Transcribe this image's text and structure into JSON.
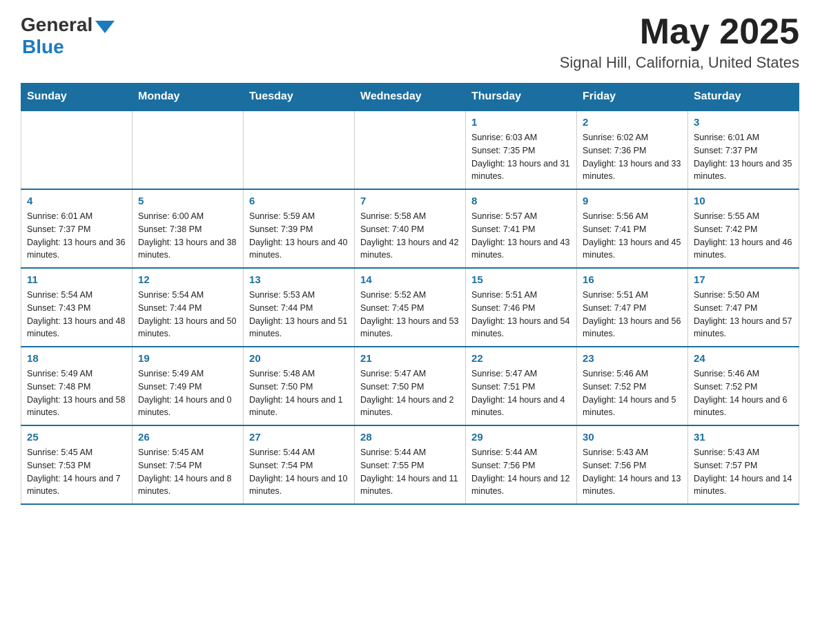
{
  "header": {
    "logo": {
      "general": "General",
      "blue": "Blue"
    },
    "title": "May 2025",
    "location": "Signal Hill, California, United States"
  },
  "calendar": {
    "days_of_week": [
      "Sunday",
      "Monday",
      "Tuesday",
      "Wednesday",
      "Thursday",
      "Friday",
      "Saturday"
    ],
    "weeks": [
      [
        {
          "day": "",
          "info": ""
        },
        {
          "day": "",
          "info": ""
        },
        {
          "day": "",
          "info": ""
        },
        {
          "day": "",
          "info": ""
        },
        {
          "day": "1",
          "info": "Sunrise: 6:03 AM\nSunset: 7:35 PM\nDaylight: 13 hours and 31 minutes."
        },
        {
          "day": "2",
          "info": "Sunrise: 6:02 AM\nSunset: 7:36 PM\nDaylight: 13 hours and 33 minutes."
        },
        {
          "day": "3",
          "info": "Sunrise: 6:01 AM\nSunset: 7:37 PM\nDaylight: 13 hours and 35 minutes."
        }
      ],
      [
        {
          "day": "4",
          "info": "Sunrise: 6:01 AM\nSunset: 7:37 PM\nDaylight: 13 hours and 36 minutes."
        },
        {
          "day": "5",
          "info": "Sunrise: 6:00 AM\nSunset: 7:38 PM\nDaylight: 13 hours and 38 minutes."
        },
        {
          "day": "6",
          "info": "Sunrise: 5:59 AM\nSunset: 7:39 PM\nDaylight: 13 hours and 40 minutes."
        },
        {
          "day": "7",
          "info": "Sunrise: 5:58 AM\nSunset: 7:40 PM\nDaylight: 13 hours and 42 minutes."
        },
        {
          "day": "8",
          "info": "Sunrise: 5:57 AM\nSunset: 7:41 PM\nDaylight: 13 hours and 43 minutes."
        },
        {
          "day": "9",
          "info": "Sunrise: 5:56 AM\nSunset: 7:41 PM\nDaylight: 13 hours and 45 minutes."
        },
        {
          "day": "10",
          "info": "Sunrise: 5:55 AM\nSunset: 7:42 PM\nDaylight: 13 hours and 46 minutes."
        }
      ],
      [
        {
          "day": "11",
          "info": "Sunrise: 5:54 AM\nSunset: 7:43 PM\nDaylight: 13 hours and 48 minutes."
        },
        {
          "day": "12",
          "info": "Sunrise: 5:54 AM\nSunset: 7:44 PM\nDaylight: 13 hours and 50 minutes."
        },
        {
          "day": "13",
          "info": "Sunrise: 5:53 AM\nSunset: 7:44 PM\nDaylight: 13 hours and 51 minutes."
        },
        {
          "day": "14",
          "info": "Sunrise: 5:52 AM\nSunset: 7:45 PM\nDaylight: 13 hours and 53 minutes."
        },
        {
          "day": "15",
          "info": "Sunrise: 5:51 AM\nSunset: 7:46 PM\nDaylight: 13 hours and 54 minutes."
        },
        {
          "day": "16",
          "info": "Sunrise: 5:51 AM\nSunset: 7:47 PM\nDaylight: 13 hours and 56 minutes."
        },
        {
          "day": "17",
          "info": "Sunrise: 5:50 AM\nSunset: 7:47 PM\nDaylight: 13 hours and 57 minutes."
        }
      ],
      [
        {
          "day": "18",
          "info": "Sunrise: 5:49 AM\nSunset: 7:48 PM\nDaylight: 13 hours and 58 minutes."
        },
        {
          "day": "19",
          "info": "Sunrise: 5:49 AM\nSunset: 7:49 PM\nDaylight: 14 hours and 0 minutes."
        },
        {
          "day": "20",
          "info": "Sunrise: 5:48 AM\nSunset: 7:50 PM\nDaylight: 14 hours and 1 minute."
        },
        {
          "day": "21",
          "info": "Sunrise: 5:47 AM\nSunset: 7:50 PM\nDaylight: 14 hours and 2 minutes."
        },
        {
          "day": "22",
          "info": "Sunrise: 5:47 AM\nSunset: 7:51 PM\nDaylight: 14 hours and 4 minutes."
        },
        {
          "day": "23",
          "info": "Sunrise: 5:46 AM\nSunset: 7:52 PM\nDaylight: 14 hours and 5 minutes."
        },
        {
          "day": "24",
          "info": "Sunrise: 5:46 AM\nSunset: 7:52 PM\nDaylight: 14 hours and 6 minutes."
        }
      ],
      [
        {
          "day": "25",
          "info": "Sunrise: 5:45 AM\nSunset: 7:53 PM\nDaylight: 14 hours and 7 minutes."
        },
        {
          "day": "26",
          "info": "Sunrise: 5:45 AM\nSunset: 7:54 PM\nDaylight: 14 hours and 8 minutes."
        },
        {
          "day": "27",
          "info": "Sunrise: 5:44 AM\nSunset: 7:54 PM\nDaylight: 14 hours and 10 minutes."
        },
        {
          "day": "28",
          "info": "Sunrise: 5:44 AM\nSunset: 7:55 PM\nDaylight: 14 hours and 11 minutes."
        },
        {
          "day": "29",
          "info": "Sunrise: 5:44 AM\nSunset: 7:56 PM\nDaylight: 14 hours and 12 minutes."
        },
        {
          "day": "30",
          "info": "Sunrise: 5:43 AM\nSunset: 7:56 PM\nDaylight: 14 hours and 13 minutes."
        },
        {
          "day": "31",
          "info": "Sunrise: 5:43 AM\nSunset: 7:57 PM\nDaylight: 14 hours and 14 minutes."
        }
      ]
    ]
  }
}
